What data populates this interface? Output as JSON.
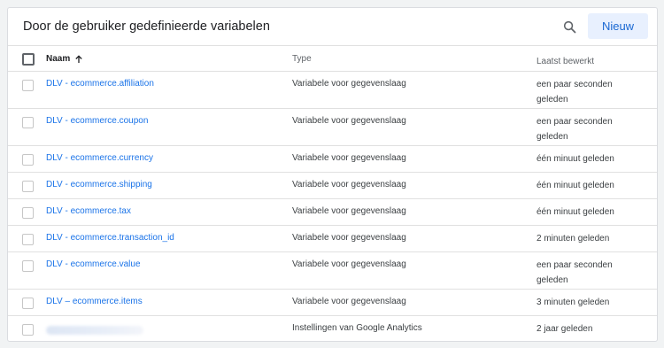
{
  "header": {
    "title": "Door de gebruiker gedefinieerde variabelen",
    "search_icon": "search-icon",
    "new_label": "Nieuw"
  },
  "table": {
    "columns": {
      "name": "Naam",
      "sort_icon": "arrow-up-icon",
      "type": "Type",
      "date": "Laatst bewerkt"
    },
    "rows": [
      {
        "name": "DLV - ecommerce.affiliation",
        "type": "Variabele voor gegevenslaag",
        "date": "een paar seconden geleden"
      },
      {
        "name": "DLV - ecommerce.coupon",
        "type": "Variabele voor gegevenslaag",
        "date": "een paar seconden geleden"
      },
      {
        "name": "DLV - ecommerce.currency",
        "type": "Variabele voor gegevenslaag",
        "date": "één minuut geleden"
      },
      {
        "name": "DLV - ecommerce.shipping",
        "type": "Variabele voor gegevenslaag",
        "date": "één minuut geleden"
      },
      {
        "name": "DLV - ecommerce.tax",
        "type": "Variabele voor gegevenslaag",
        "date": "één minuut geleden"
      },
      {
        "name": "DLV - ecommerce.transaction_id",
        "type": "Variabele voor gegevenslaag",
        "date": "2 minuten geleden"
      },
      {
        "name": "DLV - ecommerce.value",
        "type": "Variabele voor gegevenslaag",
        "date": "een paar seconden geleden"
      },
      {
        "name": "DLV – ecommerce.items",
        "type": "Variabele voor gegevenslaag",
        "date": "3 minuten geleden"
      },
      {
        "name": "",
        "type": "Instellingen van Google Analytics",
        "date": "2 jaar geleden"
      }
    ]
  },
  "colors": {
    "link": "#1a73e8",
    "button_bg": "#e8f0fe",
    "button_text": "#1967d2"
  }
}
